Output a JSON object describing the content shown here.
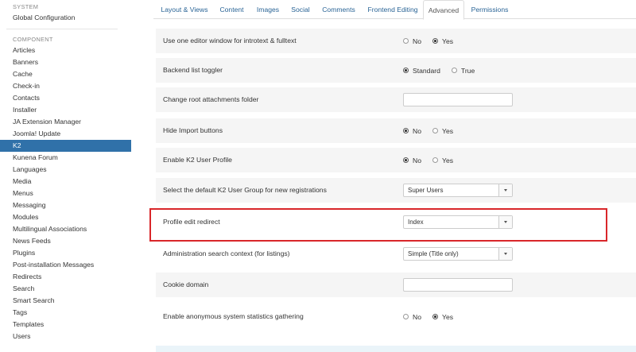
{
  "sidebar": {
    "system_heading": "SYSTEM",
    "global_config": "Global Configuration",
    "component_heading": "COMPONENT",
    "items": [
      {
        "label": "Articles",
        "active": false
      },
      {
        "label": "Banners",
        "active": false
      },
      {
        "label": "Cache",
        "active": false
      },
      {
        "label": "Check-in",
        "active": false
      },
      {
        "label": "Contacts",
        "active": false
      },
      {
        "label": "Installer",
        "active": false
      },
      {
        "label": "JA Extension Manager",
        "active": false
      },
      {
        "label": "Joomla! Update",
        "active": false
      },
      {
        "label": "K2",
        "active": true
      },
      {
        "label": "Kunena Forum",
        "active": false
      },
      {
        "label": "Languages",
        "active": false
      },
      {
        "label": "Media",
        "active": false
      },
      {
        "label": "Menus",
        "active": false
      },
      {
        "label": "Messaging",
        "active": false
      },
      {
        "label": "Modules",
        "active": false
      },
      {
        "label": "Multilingual Associations",
        "active": false
      },
      {
        "label": "News Feeds",
        "active": false
      },
      {
        "label": "Plugins",
        "active": false
      },
      {
        "label": "Post-installation Messages",
        "active": false
      },
      {
        "label": "Redirects",
        "active": false
      },
      {
        "label": "Search",
        "active": false
      },
      {
        "label": "Smart Search",
        "active": false
      },
      {
        "label": "Tags",
        "active": false
      },
      {
        "label": "Templates",
        "active": false
      },
      {
        "label": "Users",
        "active": false
      }
    ]
  },
  "tabs": [
    {
      "label": "Layout & Views",
      "active": false
    },
    {
      "label": "Content",
      "active": false
    },
    {
      "label": "Images",
      "active": false
    },
    {
      "label": "Social",
      "active": false
    },
    {
      "label": "Comments",
      "active": false
    },
    {
      "label": "Frontend Editing",
      "active": false
    },
    {
      "label": "Advanced",
      "active": true
    },
    {
      "label": "Permissions",
      "active": false
    }
  ],
  "settings": [
    {
      "label": "Use one editor window for introtext & fulltext",
      "type": "radio",
      "options": [
        "No",
        "Yes"
      ],
      "selected": "Yes"
    },
    {
      "label": "Backend list toggler",
      "type": "radio",
      "options": [
        "Standard",
        "True"
      ],
      "selected": "Standard"
    },
    {
      "label": "Change root attachments folder",
      "type": "text",
      "value": ""
    },
    {
      "label": "Hide Import buttons",
      "type": "radio",
      "options": [
        "No",
        "Yes"
      ],
      "selected": "No"
    },
    {
      "label": "Enable K2 User Profile",
      "type": "radio",
      "options": [
        "No",
        "Yes"
      ],
      "selected": "No"
    },
    {
      "label": "Select the default K2 User Group for new registrations",
      "type": "select",
      "value": "Super Users"
    },
    {
      "label": "Profile edit redirect",
      "type": "select",
      "value": "Index"
    },
    {
      "label": "Administration search context (for listings)",
      "type": "select",
      "value": "Simple (Title only)"
    },
    {
      "label": "Cookie domain",
      "type": "text",
      "value": ""
    },
    {
      "label": "Enable anonymous system statistics gathering",
      "type": "radio",
      "options": [
        "No",
        "Yes"
      ],
      "selected": "Yes"
    }
  ],
  "colors": {
    "active_sidebar": "#3071a9",
    "tab_link": "#2a6496",
    "highlight_border": "#d9262a"
  }
}
